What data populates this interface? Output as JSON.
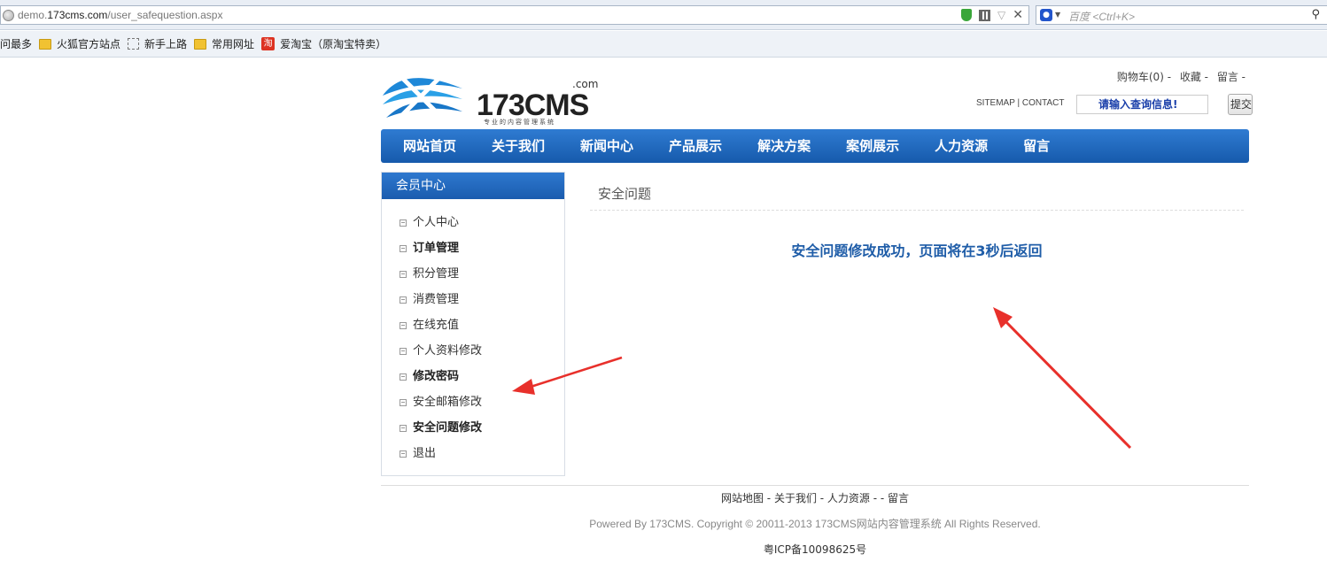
{
  "browser": {
    "url_prefix": "demo.",
    "url_domain": "173cms.com",
    "url_path": "/user_safequestion.aspx",
    "search_placeholder": "百度 <Ctrl+K>",
    "bookmarks": [
      "问最多",
      "火狐官方站点",
      "新手上路",
      "常用网址",
      "爱淘宝（原淘宝特卖）"
    ]
  },
  "header": {
    "logo_text": "173CMS",
    "logo_com": ".com",
    "logo_sub": "专业的内容管理系统",
    "top_links": [
      "购物车(0) -",
      "收藏 -",
      "留言 -"
    ],
    "sitemap_text": "SITEMAP | CONTACT",
    "search_value": "请输入查询信息!",
    "submit_label": "提交"
  },
  "nav": {
    "items": [
      "网站首页",
      "关于我们",
      "新闻中心",
      "产品展示",
      "解决方案",
      "案例展示",
      "人力资源",
      "留言"
    ]
  },
  "sidebar": {
    "title": "会员中心",
    "items": [
      "个人中心",
      "订单管理",
      "积分管理",
      "消费管理",
      "在线充值",
      "个人资料修改",
      "修改密码",
      "安全邮箱修改",
      "安全问题修改",
      "退出"
    ]
  },
  "content": {
    "title": "安全问题",
    "message": "安全问题修改成功，页面将在3秒后返回"
  },
  "footer": {
    "links": "网站地图 - 关于我们 - 人力资源 -  - 留言",
    "copyright": "Powered By 173CMS. Copyright © 20011-2013 173CMS网站内容管理系统 All Rights Reserved.",
    "icp": "粤ICP备10098625号"
  },
  "colors": {
    "nav_blue": "#1f66be",
    "message_blue": "#1f5da8",
    "annotation_red": "#e8302b"
  }
}
